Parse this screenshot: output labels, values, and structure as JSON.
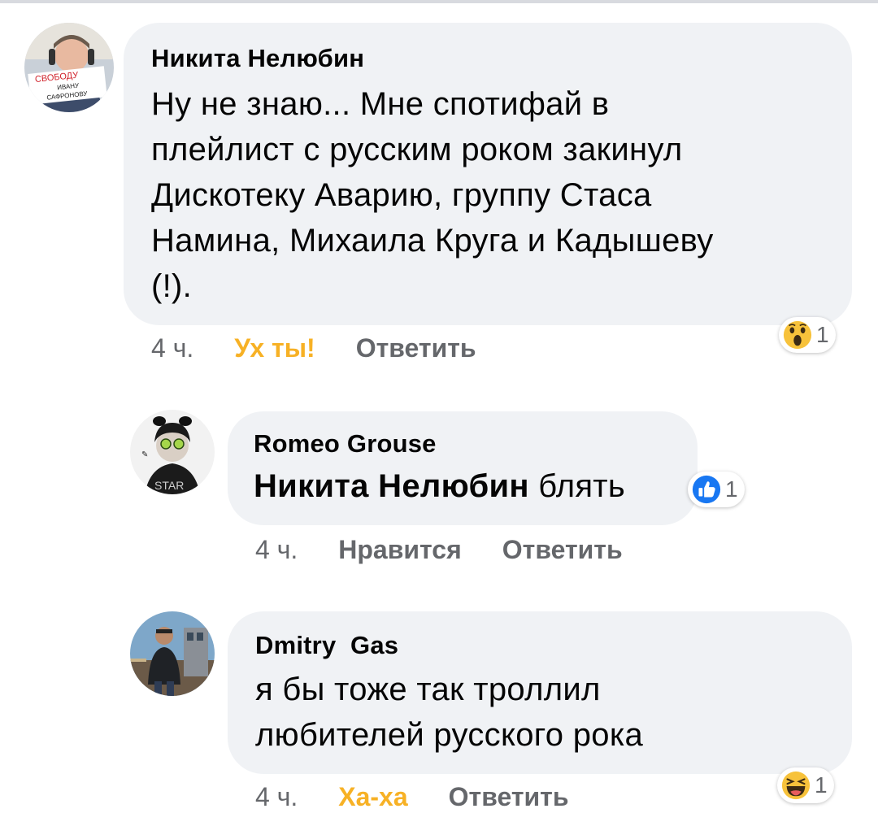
{
  "comments": [
    {
      "author": "Никита Нелюбин",
      "avatar_badge": [
        "СВОБОДУ",
        "ИВАНУ",
        "САФРОНОВУ"
      ],
      "text_lines": [
        "Ну не знаю... Мне спотифай в",
        "плейлист с русским роком закинул",
        "Дискотеку Аварию, группу Стаса",
        "Намина, Михаила Круга и Кадышеву",
        "(!)."
      ],
      "time": "4 ч.",
      "reaction_label": "Ух ты!",
      "reply_label": "Ответить",
      "reaction_icon": "wow-emoji-icon",
      "reaction_count": "1"
    },
    {
      "author": "Romeo Grouse",
      "mention": "Никита Нелюбин",
      "text": "блять",
      "time": "4 ч.",
      "like_label": "Нравится",
      "reply_label": "Ответить",
      "reaction_icon": "like-thumb-icon",
      "reaction_count": "1"
    },
    {
      "author": "Dmitry  Gas",
      "text_lines": [
        "я бы тоже так троллил",
        "любителей русского рока"
      ],
      "time": "4 ч.",
      "reaction_label": "Ха-ха",
      "reply_label": "Ответить",
      "reaction_icon": "haha-emoji-icon",
      "reaction_count": "1"
    }
  ],
  "colors": {
    "bubble": "#f0f2f5",
    "meta_text": "#65676b",
    "reaction_active": "#f7b125",
    "like_blue": "#1877f2"
  }
}
